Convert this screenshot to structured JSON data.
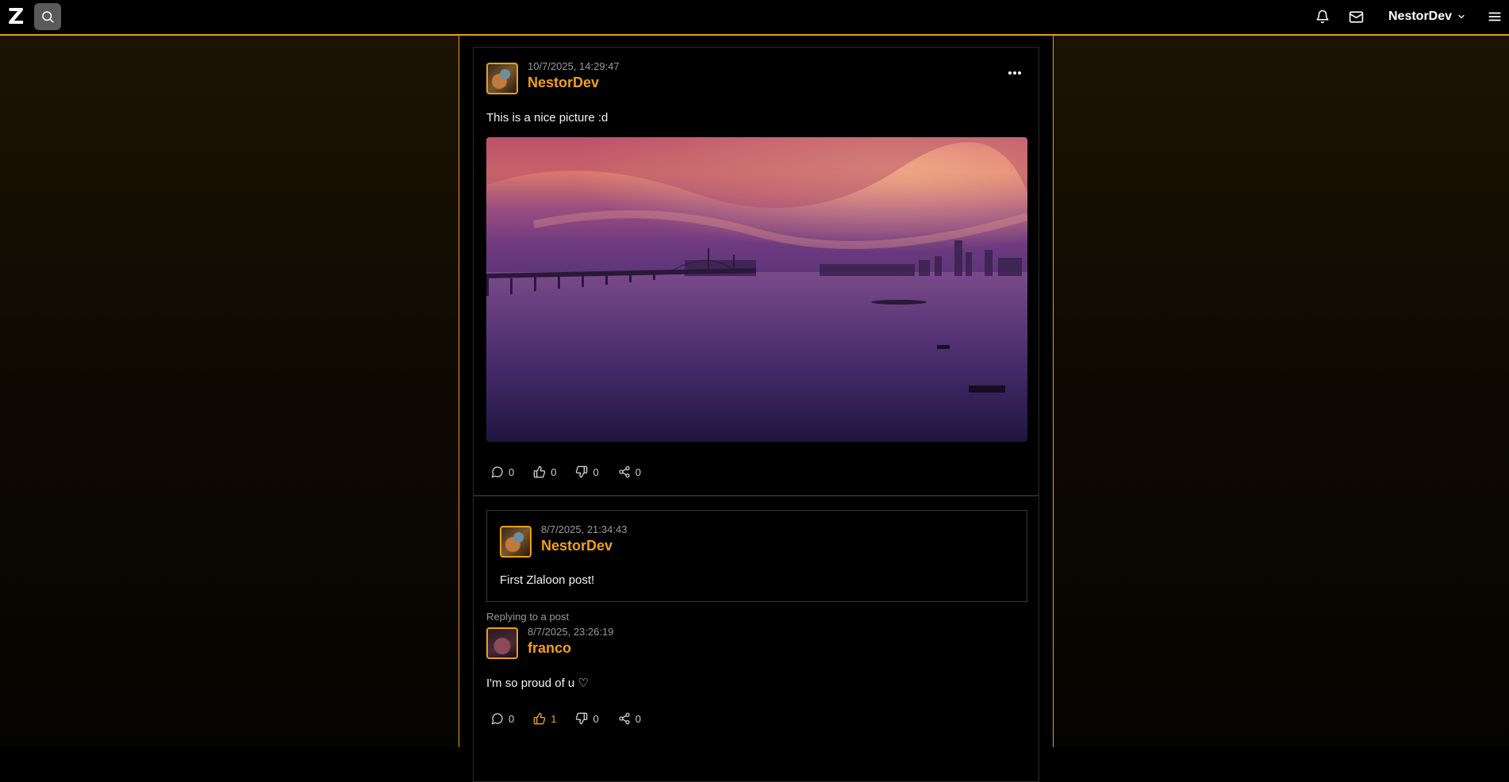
{
  "header": {
    "logo": "Z",
    "username": "NestorDev"
  },
  "posts": [
    {
      "timestamp": "10/7/2025, 14:29:47",
      "author": "NestorDev",
      "text": "This is a nice picture :d",
      "actions": {
        "comments": "0",
        "likes": "0",
        "dislikes": "0",
        "shares": "0"
      }
    },
    {
      "replying_label": "Replying to a post",
      "quoted": {
        "timestamp": "8/7/2025, 21:34:43",
        "author": "NestorDev",
        "text": "First Zlaloon post!"
      },
      "timestamp": "8/7/2025, 23:26:19",
      "author": "franco",
      "text": "I'm so proud of u ♡",
      "actions": {
        "comments": "0",
        "likes": "1",
        "dislikes": "0",
        "shares": "0"
      }
    }
  ],
  "colors": {
    "accent": "#e8a019",
    "username": "#f29f1d",
    "background": "#000000"
  },
  "icons": [
    "search-icon",
    "bell-icon",
    "mail-icon",
    "chevron-down-icon",
    "hamburger-menu-icon",
    "more-horizontal-icon",
    "comment-icon",
    "thumbs-up-icon",
    "thumbs-down-icon",
    "share-icon"
  ]
}
